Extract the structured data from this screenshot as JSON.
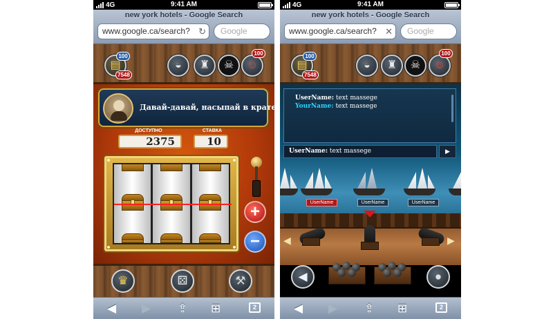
{
  "status": {
    "carrier": "4G",
    "time": "9:41 AM"
  },
  "browser": {
    "title": "new york hotels - Google Search",
    "url": "www.google.ca/search?",
    "search_placeholder": "Google"
  },
  "top_hud": {
    "gold_count": "100",
    "coin_count": "7548",
    "captain_badge": "100",
    "icons": [
      "treasure-icon",
      "helmet-icon",
      "tower-icon",
      "jolly-roger-icon",
      "pirate-captain-icon"
    ]
  },
  "slot": {
    "dialog_text": "Давай-давай, насыпай в кратер!",
    "available_label": "ДОСТУПНО",
    "available_value": "2375",
    "bet_label": "СТАВКА",
    "bet_value": "10",
    "plus_label": "+",
    "minus_label": "−"
  },
  "chat": {
    "lines": [
      {
        "name": "UserName:",
        "text": "text massege"
      },
      {
        "name": "YourName:",
        "text": "text massege"
      }
    ],
    "input": {
      "name": "UserName:",
      "text": "text massege"
    },
    "send_label": "▶"
  },
  "ships": [
    {
      "label": "UserName",
      "selected": true
    },
    {
      "label": "UserName",
      "selected": false
    },
    {
      "label": "UserName",
      "selected": false
    }
  ],
  "bottom_left": {
    "icons": [
      "crown-icon",
      "dice-icon",
      "hammers-icon"
    ]
  },
  "bottom_right": {
    "icons": [
      "back-arrow-icon",
      "cannonballs-icon"
    ]
  },
  "toolbar": {
    "tabs_count": "2"
  },
  "colors": {
    "accent_gold": "#d8a73a",
    "chat_name_you": "#2dd4ff",
    "selected_label": "#b01818"
  }
}
